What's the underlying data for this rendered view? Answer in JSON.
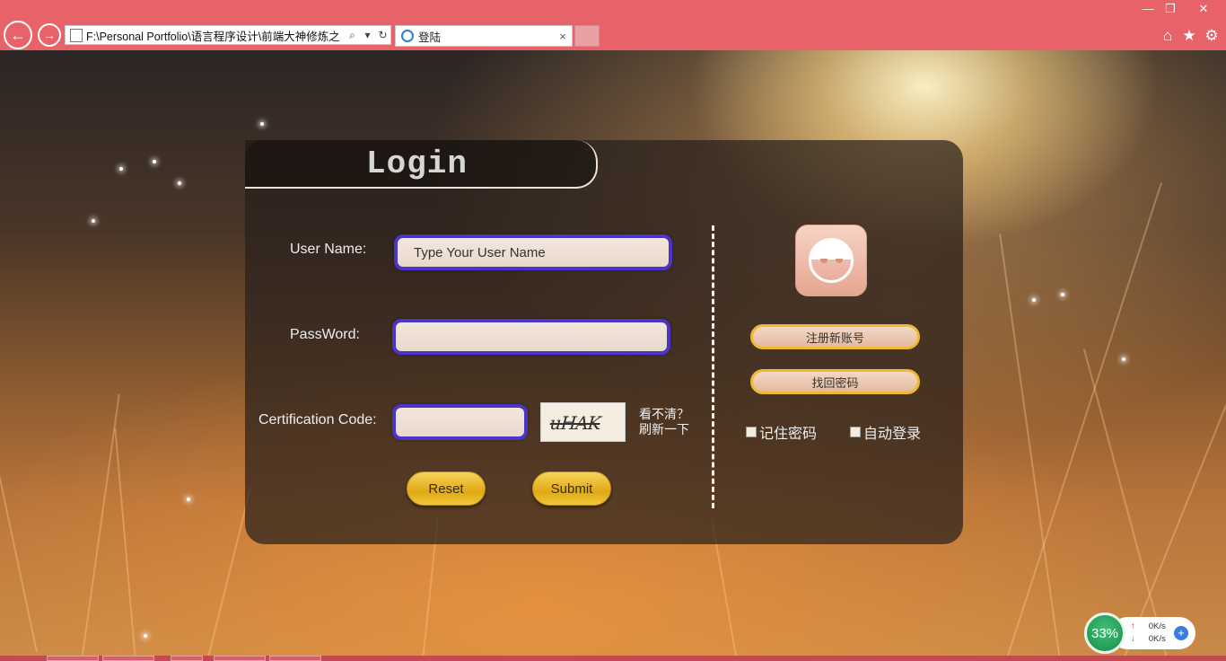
{
  "browser": {
    "address": "F:\\Personal Portfolio\\语言程序设计\\前端大神修炼之",
    "tab_title": "登陆",
    "tab_close": "×",
    "back_glyph": "←",
    "forward_glyph": "→",
    "search_glyph": "⌕",
    "dropdown_glyph": "▾",
    "refresh_glyph": "↻",
    "icons": [
      "home-icon",
      "star-icon",
      "gear-icon"
    ],
    "window_controls": {
      "minimize": "—",
      "restore": "❐",
      "close": "✕"
    },
    "toolbar_glyphs": {
      "home": "⌂",
      "star": "★",
      "gear": "⚙"
    }
  },
  "login": {
    "title": "Login",
    "username_label": "User Name:",
    "username_placeholder": "Type Your User Name",
    "password_label": "PassWord:",
    "password_value": "",
    "code_label": "Certification Code:",
    "code_value": "",
    "captcha_text": "uHAK",
    "refresh_hint_line1": "看不清？",
    "refresh_hint_line2": "刷新一下",
    "reset_label": "Reset",
    "submit_label": "Submit"
  },
  "side": {
    "register_label": "注册新账号",
    "recover_label": "找回密码",
    "remember_label": "记住密码",
    "autologin_label": "自动登录",
    "remember_checked": false,
    "autologin_checked": false
  },
  "tray": {
    "percent": "33%",
    "upload": "0K/s",
    "download": "0K/s",
    "up_arrow": "↑",
    "down_arrow": "↓",
    "plus": "+"
  },
  "colors": {
    "chrome": "#e8626a",
    "field_border": "#4b34c8",
    "gold": "#e1a915"
  }
}
